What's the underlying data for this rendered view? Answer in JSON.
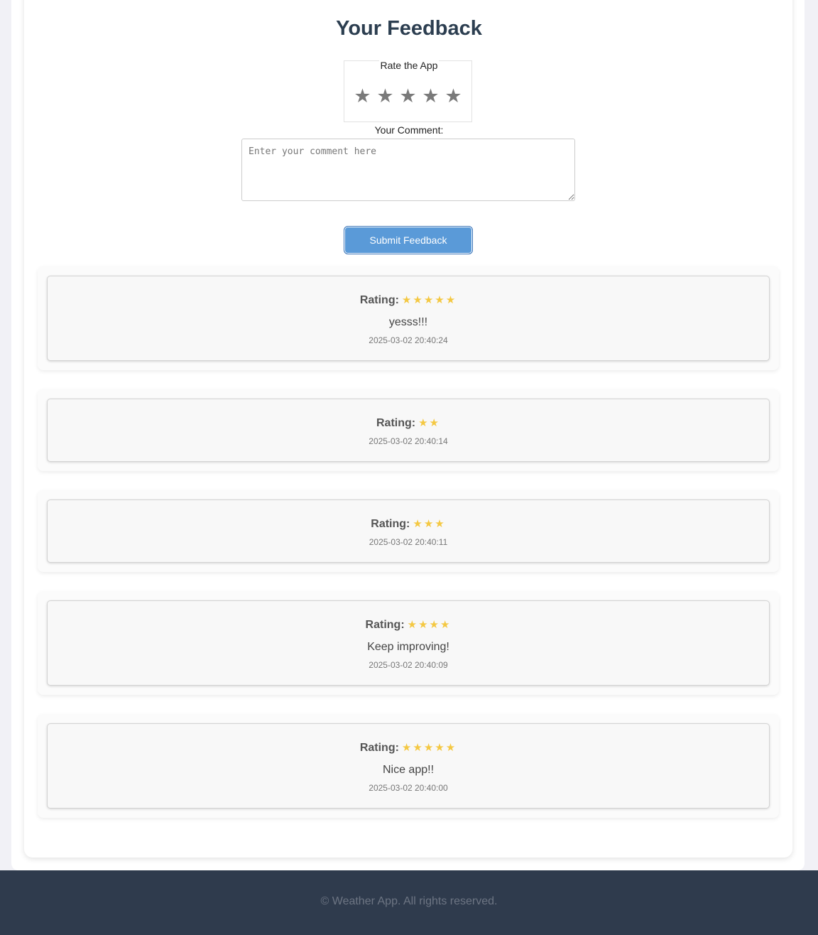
{
  "page": {
    "title": "Your Feedback"
  },
  "form": {
    "rate_legend": "Rate the App",
    "star_glyph": "★",
    "star_count": 5,
    "comment_label": "Your Comment:",
    "comment_placeholder": "Enter your comment here",
    "comment_value": "",
    "submit_label": "Submit Feedback"
  },
  "feedback": [
    {
      "rating_label": "Rating:",
      "stars": "★★★★★",
      "rating": 5,
      "comment": "yesss!!!",
      "timestamp": "2025-03-02 20:40:24"
    },
    {
      "rating_label": "Rating:",
      "stars": "★★",
      "rating": 2,
      "comment": "",
      "timestamp": "2025-03-02 20:40:14"
    },
    {
      "rating_label": "Rating:",
      "stars": "★★★",
      "rating": 3,
      "comment": "",
      "timestamp": "2025-03-02 20:40:11"
    },
    {
      "rating_label": "Rating:",
      "stars": "★★★★",
      "rating": 4,
      "comment": "Keep improving!",
      "timestamp": "2025-03-02 20:40:09"
    },
    {
      "rating_label": "Rating:",
      "stars": "★★★★★",
      "rating": 5,
      "comment": "Nice app!!",
      "timestamp": "2025-03-02 20:40:00"
    }
  ],
  "footer": {
    "text": "© Weather App. All rights reserved."
  },
  "colors": {
    "accent": "#5a9ad8",
    "star_filled": "#f4c842",
    "star_empty": "#7a7a7a",
    "title": "#2c3e50",
    "footer_bg": "#2f3b4d"
  }
}
